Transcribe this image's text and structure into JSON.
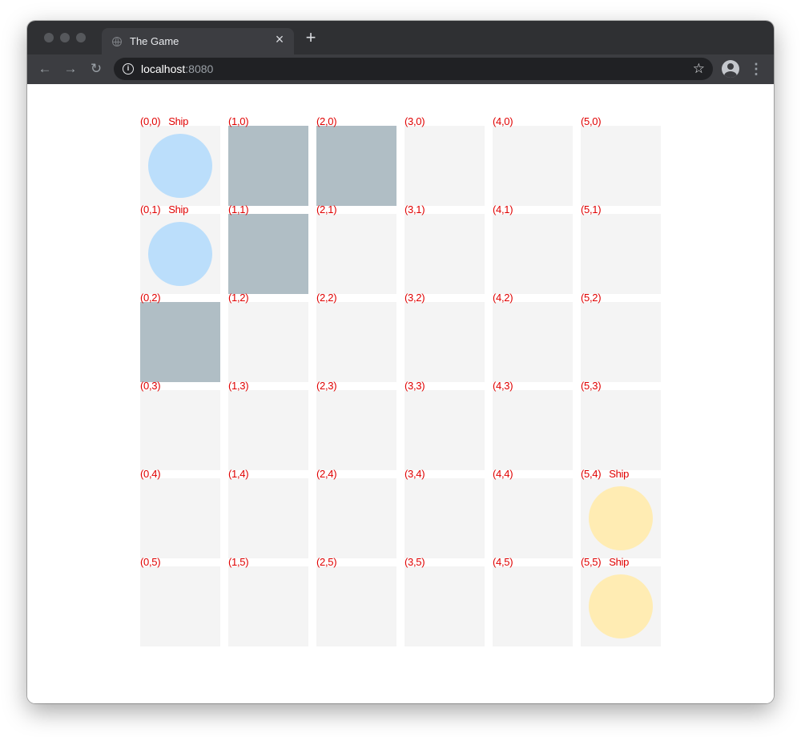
{
  "browser": {
    "tab_title": "The Game",
    "close_icon": "close-icon",
    "new_tab_icon": "plus-icon",
    "url_host": "localhost",
    "url_port": ":8080",
    "icons": [
      "back-arrow-icon",
      "forward-arrow-icon",
      "reload-icon",
      "info-icon",
      "star-icon",
      "profile-icon",
      "menu-icon"
    ],
    "back_glyph": "←",
    "forward_glyph": "→",
    "reload_glyph": "↻"
  },
  "board": {
    "columns": 6,
    "rows": 6,
    "ship_label": "Ship",
    "colors": {
      "empty": "#f4f4f4",
      "wall": "#b0bec5",
      "blue_ship": "#bbdefb",
      "yellow_ship": "#ffecb3",
      "label": "#e00000"
    },
    "cells": [
      {
        "label": "(0,0)",
        "col": 0,
        "row": 0,
        "type": "ship",
        "ship": "blue"
      },
      {
        "label": "(1,0)",
        "col": 1,
        "row": 0,
        "type": "wall"
      },
      {
        "label": "(2,0)",
        "col": 2,
        "row": 0,
        "type": "wall"
      },
      {
        "label": "(3,0)",
        "col": 3,
        "row": 0,
        "type": "empty"
      },
      {
        "label": "(4,0)",
        "col": 4,
        "row": 0,
        "type": "empty"
      },
      {
        "label": "(5,0)",
        "col": 5,
        "row": 0,
        "type": "empty"
      },
      {
        "label": "(0,1)",
        "col": 0,
        "row": 1,
        "type": "ship",
        "ship": "blue"
      },
      {
        "label": "(1,1)",
        "col": 1,
        "row": 1,
        "type": "wall"
      },
      {
        "label": "(2,1)",
        "col": 2,
        "row": 1,
        "type": "empty"
      },
      {
        "label": "(3,1)",
        "col": 3,
        "row": 1,
        "type": "empty"
      },
      {
        "label": "(4,1)",
        "col": 4,
        "row": 1,
        "type": "empty"
      },
      {
        "label": "(5,1)",
        "col": 5,
        "row": 1,
        "type": "empty"
      },
      {
        "label": "(0,2)",
        "col": 0,
        "row": 2,
        "type": "wall"
      },
      {
        "label": "(1,2)",
        "col": 1,
        "row": 2,
        "type": "empty"
      },
      {
        "label": "(2,2)",
        "col": 2,
        "row": 2,
        "type": "empty"
      },
      {
        "label": "(3,2)",
        "col": 3,
        "row": 2,
        "type": "empty"
      },
      {
        "label": "(4,2)",
        "col": 4,
        "row": 2,
        "type": "empty"
      },
      {
        "label": "(5,2)",
        "col": 5,
        "row": 2,
        "type": "empty"
      },
      {
        "label": "(0,3)",
        "col": 0,
        "row": 3,
        "type": "empty"
      },
      {
        "label": "(1,3)",
        "col": 1,
        "row": 3,
        "type": "empty"
      },
      {
        "label": "(2,3)",
        "col": 2,
        "row": 3,
        "type": "empty"
      },
      {
        "label": "(3,3)",
        "col": 3,
        "row": 3,
        "type": "empty"
      },
      {
        "label": "(4,3)",
        "col": 4,
        "row": 3,
        "type": "empty"
      },
      {
        "label": "(5,3)",
        "col": 5,
        "row": 3,
        "type": "empty"
      },
      {
        "label": "(0,4)",
        "col": 0,
        "row": 4,
        "type": "empty"
      },
      {
        "label": "(1,4)",
        "col": 1,
        "row": 4,
        "type": "empty"
      },
      {
        "label": "(2,4)",
        "col": 2,
        "row": 4,
        "type": "empty"
      },
      {
        "label": "(3,4)",
        "col": 3,
        "row": 4,
        "type": "empty"
      },
      {
        "label": "(4,4)",
        "col": 4,
        "row": 4,
        "type": "empty"
      },
      {
        "label": "(5,4)",
        "col": 5,
        "row": 4,
        "type": "ship",
        "ship": "yellow"
      },
      {
        "label": "(0,5)",
        "col": 0,
        "row": 5,
        "type": "empty"
      },
      {
        "label": "(1,5)",
        "col": 1,
        "row": 5,
        "type": "empty"
      },
      {
        "label": "(2,5)",
        "col": 2,
        "row": 5,
        "type": "empty"
      },
      {
        "label": "(3,5)",
        "col": 3,
        "row": 5,
        "type": "empty"
      },
      {
        "label": "(4,5)",
        "col": 4,
        "row": 5,
        "type": "empty"
      },
      {
        "label": "(5,5)",
        "col": 5,
        "row": 5,
        "type": "ship",
        "ship": "yellow"
      }
    ]
  }
}
